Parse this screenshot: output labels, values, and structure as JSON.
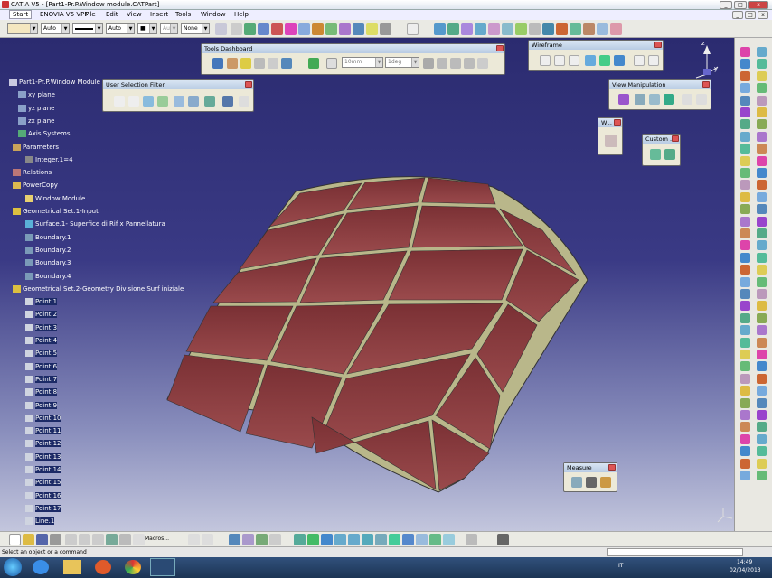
{
  "window": {
    "title": "CATIA V5 - [Part1-Pr.P.Window module.CATPart]"
  },
  "menubar": [
    "Start",
    "ENOVIA V5 VPM",
    "File",
    "Edit",
    "View",
    "Insert",
    "Tools",
    "Window",
    "Help"
  ],
  "toolbar": {
    "color_value": "",
    "line_weight": "Auto",
    "line_type_value": "",
    "point_type": "Auto",
    "layer_value": "None",
    "combo_aux": "Aut"
  },
  "tree": [
    {
      "label": "Part1-Pr.P.Window Module",
      "icon": "part-icon"
    },
    {
      "label": "xy plane",
      "icon": "plane-icon"
    },
    {
      "label": "yz plane",
      "icon": "plane-icon"
    },
    {
      "label": "zx plane",
      "icon": "plane-icon"
    },
    {
      "label": "Axis Systems",
      "icon": "axis-icon"
    },
    {
      "label": "Parameters",
      "icon": "parameters-icon"
    },
    {
      "label": "Integer.1=4",
      "icon": "integer-icon"
    },
    {
      "label": "Relations",
      "icon": "relations-icon"
    },
    {
      "label": "PowerCopy",
      "icon": "powercopy-icon"
    },
    {
      "label": "Window Module",
      "icon": "folder-icon"
    },
    {
      "label": "Geometrical Set.1-Input",
      "icon": "geoset-icon"
    },
    {
      "label": "Surface.1- Superfice di Rif x Pannellatura",
      "icon": "surface-icon"
    },
    {
      "label": "Boundary.1",
      "icon": "boundary-icon"
    },
    {
      "label": "Boundary.2",
      "icon": "boundary-icon"
    },
    {
      "label": "Boundary.3",
      "icon": "boundary-icon"
    },
    {
      "label": "Boundary.4",
      "icon": "boundary-icon"
    },
    {
      "label": "Geometrical Set.2-Geometry Divisione Surf iniziale",
      "icon": "geoset-icon"
    },
    {
      "label": "Point.1",
      "icon": "point-icon"
    },
    {
      "label": "Point.2",
      "icon": "point-icon"
    },
    {
      "label": "Point.3",
      "icon": "point-icon"
    },
    {
      "label": "Point.4",
      "icon": "point-icon"
    },
    {
      "label": "Point.5",
      "icon": "point-icon"
    },
    {
      "label": "Point.6",
      "icon": "point-icon"
    },
    {
      "label": "Point.7",
      "icon": "point-icon"
    },
    {
      "label": "Point.8",
      "icon": "point-icon"
    },
    {
      "label": "Point.9",
      "icon": "point-icon"
    },
    {
      "label": "Point.10",
      "icon": "point-icon"
    },
    {
      "label": "Point.11",
      "icon": "point-icon"
    },
    {
      "label": "Point.12",
      "icon": "point-icon"
    },
    {
      "label": "Point.13",
      "icon": "point-icon"
    },
    {
      "label": "Point.14",
      "icon": "point-icon"
    },
    {
      "label": "Point.15",
      "icon": "point-icon"
    },
    {
      "label": "Point.16",
      "icon": "point-icon"
    },
    {
      "label": "Point.17",
      "icon": "point-icon"
    },
    {
      "label": "Line.1",
      "icon": "line-icon"
    }
  ],
  "panels": {
    "tools_dashboard": {
      "title": "Tools Dashboard",
      "length": "10mm",
      "angle": "1deg"
    },
    "wireframe": {
      "title": "Wireframe"
    },
    "user_selection_filter": {
      "title": "User Selection Filter"
    },
    "view_manipulation": {
      "title": "View Manipulation"
    },
    "w_panel": {
      "title": "W..."
    },
    "custom_panel": {
      "title": "Custom ..."
    },
    "measure": {
      "title": "Measure"
    }
  },
  "bottom": {
    "macros_label": "Macros..."
  },
  "status": {
    "prompt": "Select an object or a command"
  },
  "taskbar": {
    "lang": "IT",
    "time": "14:49",
    "date": "02/04/2013"
  },
  "compass": {
    "x": "x",
    "y": "y",
    "z": "z"
  },
  "colors": {
    "surface": "#8b3b3e",
    "grid": "#b9b78a",
    "bg_top": "#2b2b70",
    "bg_bottom": "#c3c6dd"
  }
}
